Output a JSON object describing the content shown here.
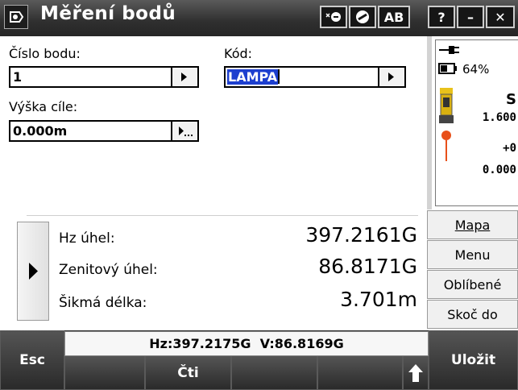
{
  "window": {
    "title": "Měření bodů",
    "buttons": [
      {
        "name": "toggle-laser-button",
        "label": ""
      },
      {
        "name": "no-entry-button",
        "label": ""
      },
      {
        "name": "ab-mode-button",
        "label": "AB"
      },
      {
        "name": "help-button",
        "label": "?"
      },
      {
        "name": "minimize-button",
        "label": "–"
      },
      {
        "name": "close-button",
        "label": "✕"
      }
    ]
  },
  "form": {
    "point_number_label": "Číslo bodu:",
    "point_number_value": "1",
    "code_label": "Kód:",
    "code_value": "LAMPA",
    "target_height_label": "Výška cíle:",
    "target_height_value": "0.000m"
  },
  "measurements": [
    {
      "label": "Hz úhel:",
      "value": "397.2161G"
    },
    {
      "label": "Zenitový úhel:",
      "value": "86.8171G"
    },
    {
      "label": "Šikmá délka:",
      "value": "3.701m"
    }
  ],
  "status_panel": {
    "battery_percent": "64%",
    "instrument_mode": "S",
    "instrument_height": "1.600",
    "prism_offset": "+0",
    "prism_height": "0.000"
  },
  "side_buttons": [
    "Mapa",
    "Menu",
    "Oblíbené",
    "Skoč do"
  ],
  "footer": {
    "esc_label": "Esc",
    "readout": "Hz:397.2175G  V:86.8169G",
    "read_label": "Čti",
    "save_label": "Uložit"
  },
  "colors": {
    "titlebar": "#2f2f2f",
    "selection": "#1d3fcf",
    "footer": "#262626"
  }
}
